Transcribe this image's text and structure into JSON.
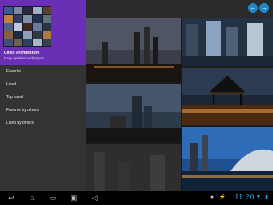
{
  "app": {
    "title": "Cities Architecture",
    "subtitle": "Daily updated wallpapers"
  },
  "menu": {
    "items": [
      {
        "label": "Favorite"
      },
      {
        "label": "Liked"
      },
      {
        "label": "Top rated"
      },
      {
        "label": "Favorite by others"
      },
      {
        "label": "Liked by others"
      }
    ]
  },
  "toolbar": {
    "prev_icon": "arrow-left-icon",
    "next_icon": "arrow-right-icon",
    "prev_glyph": "←",
    "next_glyph": "→"
  },
  "statusbar": {
    "time": "11:20",
    "icons": {
      "back": "↩",
      "home": "⌂",
      "recent": "▭",
      "screenshot": "▣",
      "volume": "◁"
    }
  },
  "colors": {
    "drawer_header": "#6a2fb5",
    "accent": "#1f86c7",
    "clock": "#2b9fe0"
  }
}
